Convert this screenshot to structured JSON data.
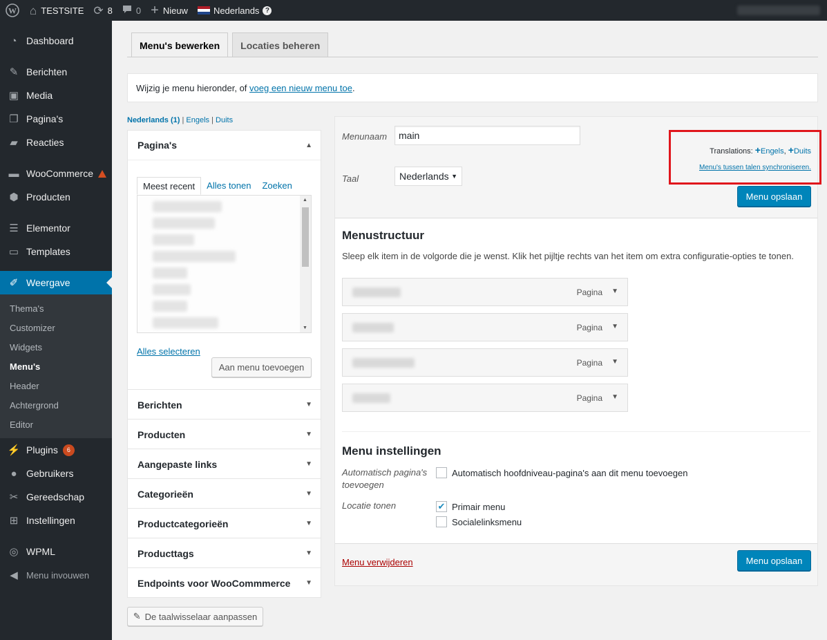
{
  "adminbar": {
    "site_name": "TESTSITE",
    "updates_count": "8",
    "comments_count": "0",
    "new_label": "Nieuw",
    "language": "Nederlands",
    "help": "?"
  },
  "sidebar": {
    "items": [
      {
        "label": "Dashboard",
        "icon": "dashboard-icon"
      },
      {
        "label": "Berichten",
        "icon": "pin-icon"
      },
      {
        "label": "Media",
        "icon": "media-icon"
      },
      {
        "label": "Pagina's",
        "icon": "page-icon"
      },
      {
        "label": "Reacties",
        "icon": "comment-icon"
      },
      {
        "label": "WooCommerce",
        "icon": "woocommerce-icon"
      },
      {
        "label": "Producten",
        "icon": "box-icon"
      },
      {
        "label": "Elementor",
        "icon": "elementor-icon"
      },
      {
        "label": "Templates",
        "icon": "folder-icon"
      },
      {
        "label": "Weergave",
        "icon": "brush-icon"
      },
      {
        "label": "Plugins",
        "icon": "plug-icon",
        "badge": "6"
      },
      {
        "label": "Gebruikers",
        "icon": "user-icon"
      },
      {
        "label": "Gereedschap",
        "icon": "wrench-icon"
      },
      {
        "label": "Instellingen",
        "icon": "settings-icon"
      },
      {
        "label": "WPML",
        "icon": "wpml-icon"
      },
      {
        "label": "Menu invouwen",
        "icon": "collapse-icon"
      }
    ],
    "submenu": [
      "Thema's",
      "Customizer",
      "Widgets",
      "Menu's",
      "Header",
      "Achtergrond",
      "Editor"
    ]
  },
  "tabs": {
    "edit": "Menu's bewerken",
    "locations": "Locaties beheren"
  },
  "notice": {
    "text": "Wijzig je menu hieronder, of ",
    "link": "voeg een nieuw menu toe",
    "after": "."
  },
  "lang_links": {
    "current": "Nederlands (1)",
    "sep1": " | ",
    "en": "Engels",
    "sep2": " | ",
    "de": "Duits"
  },
  "pages_panel": {
    "title": "Pagina's",
    "tabs": [
      "Meest recent",
      "Alles tonen",
      "Zoeken"
    ],
    "select_all": "Alles selecteren",
    "add_button": "Aan menu toevoegen"
  },
  "accordions": [
    "Berichten",
    "Producten",
    "Aangepaste links",
    "Categorieën",
    "Productcategorieën",
    "Producttags",
    "Endpoints voor WooCommmerce"
  ],
  "switcher_button": "De taalwisselaar aanpassen",
  "menu_header": {
    "name_label": "Menunaam",
    "name_value": "main",
    "lang_label": "Taal",
    "lang_value": "Nederlands",
    "translations_label": "Translations:",
    "translation_en": "Engels",
    "translation_sep": ",",
    "translation_de": "Duits",
    "sync_link": "Menu's tussen talen synchroniseren.",
    "save": "Menu opslaan"
  },
  "structure": {
    "title": "Menustructuur",
    "description": "Sleep elk item in de volgorde die je wenst. Klik het pijltje rechts van het item om extra configuratie-opties te tonen.",
    "items": [
      {
        "type": "Pagina"
      },
      {
        "type": "Pagina"
      },
      {
        "type": "Pagina"
      },
      {
        "type": "Pagina"
      }
    ]
  },
  "settings": {
    "title": "Menu instellingen",
    "auto_label": "Automatisch pagina's toevoegen",
    "auto_option": "Automatisch hoofdniveau-pagina's aan dit menu toevoegen",
    "location_label": "Locatie tonen",
    "primary": "Primair menu",
    "social": "Socialelinksmenu"
  },
  "footer": {
    "delete": "Menu verwijderen",
    "save": "Menu opslaan"
  }
}
